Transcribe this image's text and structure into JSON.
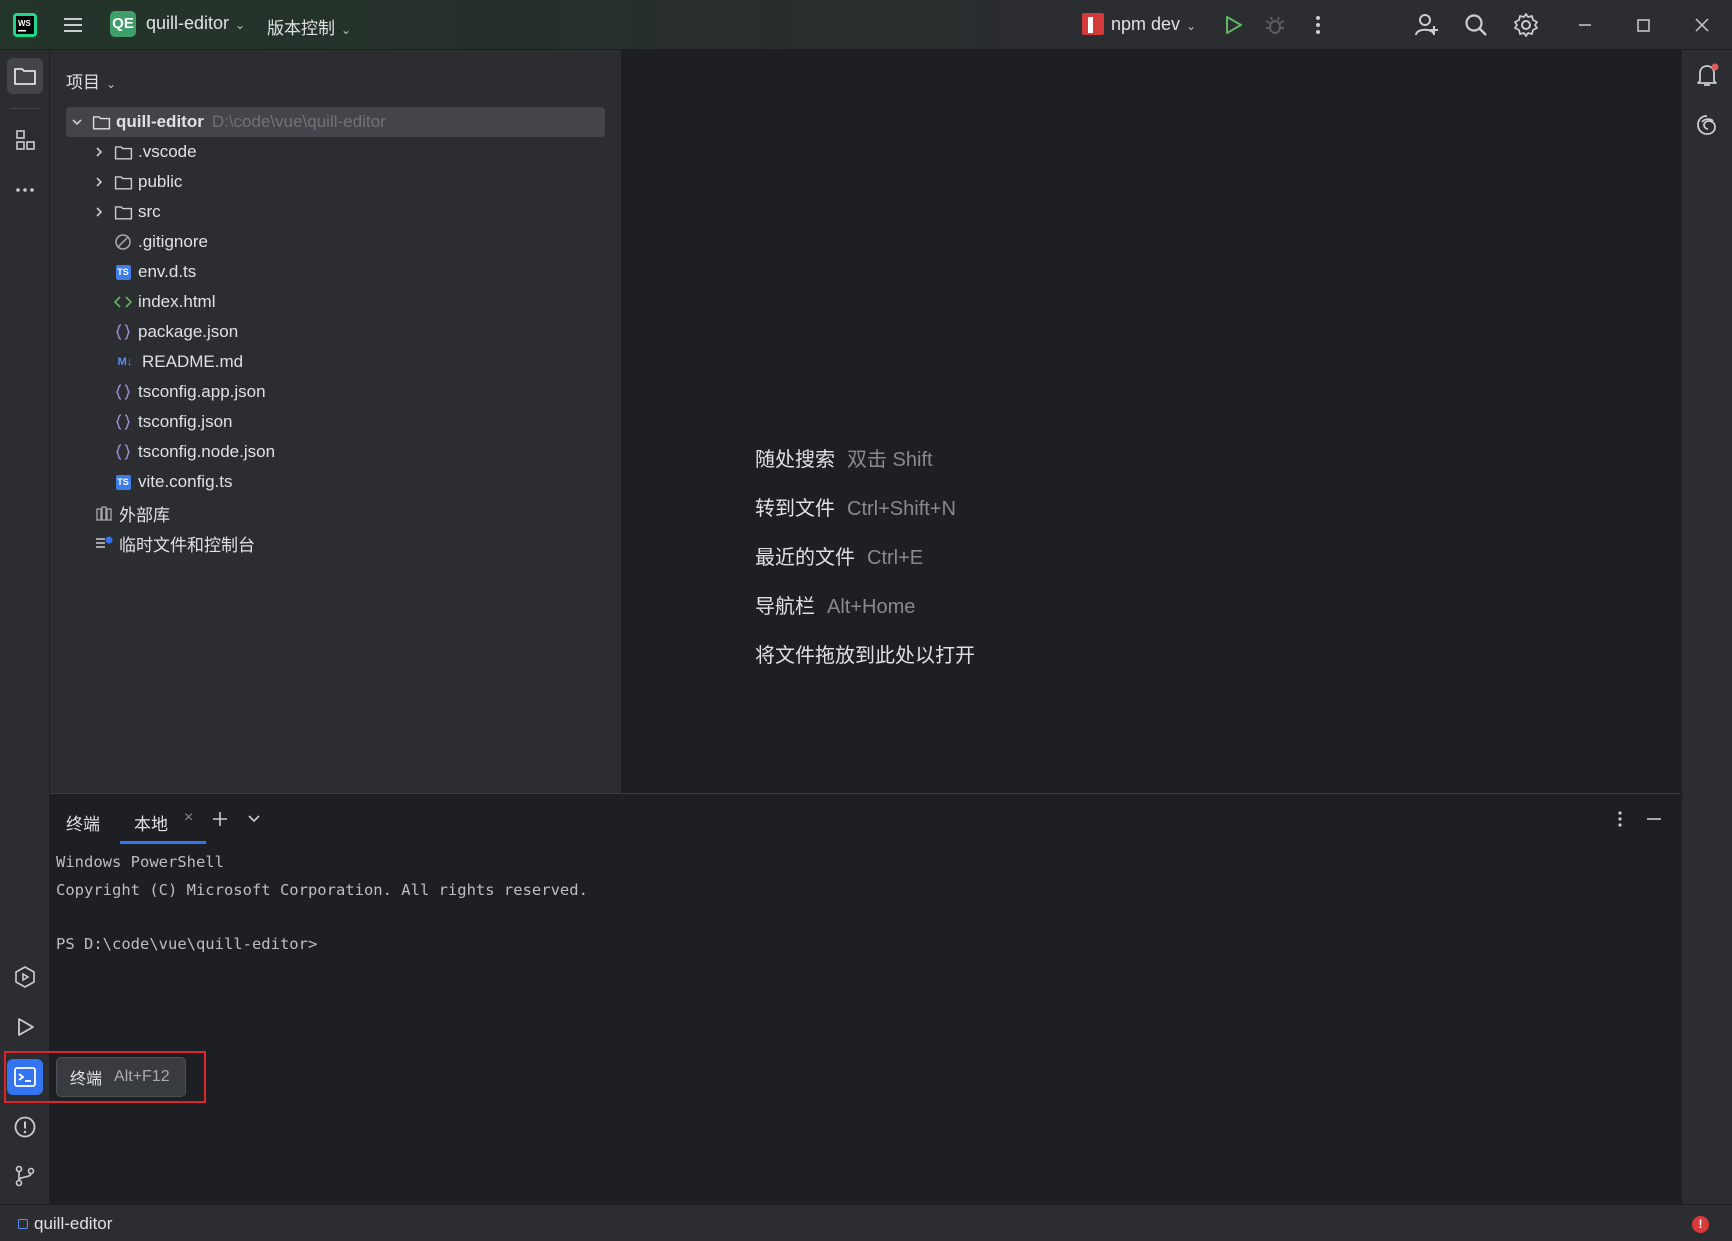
{
  "titlebar": {
    "project_badge": "QE",
    "project_name": "quill-editor",
    "vcs_label": "版本控制",
    "run_config": "npm dev"
  },
  "project_panel": {
    "title": "项目",
    "root": {
      "name": "quill-editor",
      "path": "D:\\code\\vue\\quill-editor"
    },
    "items": [
      {
        "label": ".vscode",
        "icon": "folder-icon"
      },
      {
        "label": "public",
        "icon": "folder-icon"
      },
      {
        "label": "src",
        "icon": "folder-icon"
      },
      {
        "label": ".gitignore",
        "icon": "gitignore-icon"
      },
      {
        "label": "env.d.ts",
        "icon": "typescript-file-icon"
      },
      {
        "label": "index.html",
        "icon": "html-file-icon"
      },
      {
        "label": "package.json",
        "icon": "json-file-icon"
      },
      {
        "label": "README.md",
        "icon": "markdown-file-icon"
      },
      {
        "label": "tsconfig.app.json",
        "icon": "json-file-icon"
      },
      {
        "label": "tsconfig.json",
        "icon": "json-file-icon"
      },
      {
        "label": "tsconfig.node.json",
        "icon": "json-file-icon"
      },
      {
        "label": "vite.config.ts",
        "icon": "typescript-file-icon"
      }
    ],
    "external_libs": "外部库",
    "scratches": "临时文件和控制台",
    "ts_badge": "TS",
    "md_badge": "M↓"
  },
  "editor": {
    "hints": [
      {
        "label": "随处搜索",
        "key": "双击 Shift"
      },
      {
        "label": "转到文件",
        "key": "Ctrl+Shift+N"
      },
      {
        "label": "最近的文件",
        "key": "Ctrl+E"
      },
      {
        "label": "导航栏",
        "key": "Alt+Home"
      },
      {
        "label": "将文件拖放到此处以打开",
        "key": ""
      }
    ]
  },
  "terminal": {
    "title": "终端",
    "tab_label": "本地",
    "lines": [
      "Windows PowerShell",
      "Copyright (C) Microsoft Corporation. All rights reserved.",
      "",
      "PS D:\\code\\vue\\quill-editor>"
    ]
  },
  "tooltip": {
    "label": "终端",
    "shortcut": "Alt+F12"
  },
  "statusbar": {
    "project": "quill-editor",
    "error_badge": "!"
  },
  "colors": {
    "accent": "#3574f0",
    "highlight_box": "#e0242b",
    "project_badge": "#3f9f6a"
  }
}
